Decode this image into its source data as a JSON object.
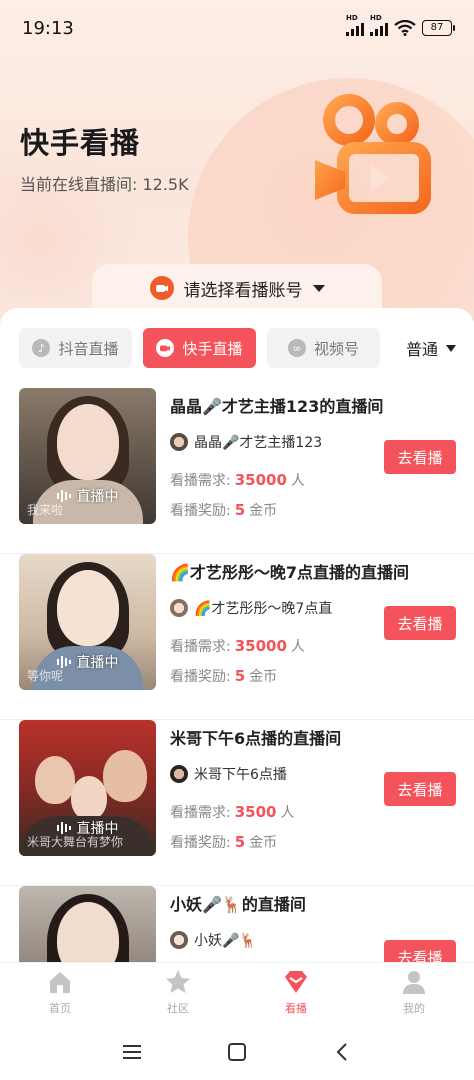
{
  "status_bar": {
    "time": "19:13",
    "battery": "87",
    "signal_badge": "HD"
  },
  "header": {
    "title": "快手看播",
    "subtitle": "当前在线直播间: 12.5K",
    "logo_icon": "kuaishou-logo-icon"
  },
  "account_selector": {
    "label": "请选择看播账号"
  },
  "tabs": [
    {
      "label": "抖音直播",
      "icon": "douyin-icon",
      "active": false
    },
    {
      "label": "快手直播",
      "icon": "kuaishou-icon",
      "active": true
    },
    {
      "label": "视频号",
      "icon": "channels-icon",
      "active": false
    }
  ],
  "mode": {
    "label": "普通"
  },
  "stream_list": [
    {
      "title": "晶晶🎤才艺主播123的直播间",
      "host": "晶晶🎤才艺主播123",
      "live_label": "直播中",
      "caption": "我来啦",
      "demand_label": "看播需求:",
      "demand_value": "35000",
      "demand_unit": "人",
      "reward_label": "看播奖励:",
      "reward_value": "5",
      "reward_unit": "金币",
      "button": "去看播"
    },
    {
      "title": "🌈才艺彤彤～晚7点直播的直播间",
      "host": "🌈才艺彤彤～晚7点直",
      "live_label": "直播中",
      "caption": "等你呢",
      "demand_label": "看播需求:",
      "demand_value": "35000",
      "demand_unit": "人",
      "reward_label": "看播奖励:",
      "reward_value": "5",
      "reward_unit": "金币",
      "button": "去看播"
    },
    {
      "title": "米哥下午6点播的直播间",
      "host": "米哥下午6点播",
      "live_label": "直播中",
      "caption": "米哥大舞台有梦你",
      "demand_label": "看播需求:",
      "demand_value": "3500",
      "demand_unit": "人",
      "reward_label": "看播奖励:",
      "reward_value": "5",
      "reward_unit": "金币",
      "button": "去看播"
    },
    {
      "title": "小妖🎤🦌的直播间",
      "host": "小妖🎤🦌",
      "live_label": "",
      "caption": "",
      "demand_label": "",
      "demand_value": "",
      "demand_unit": "",
      "reward_label": "",
      "reward_value": "",
      "reward_unit": "",
      "button": "去看播"
    }
  ],
  "bottom_nav": [
    {
      "label": "首页",
      "icon": "home-icon",
      "active": false
    },
    {
      "label": "社区",
      "icon": "star-icon",
      "active": false
    },
    {
      "label": "看播",
      "icon": "diamond-icon",
      "active": true
    },
    {
      "label": "我的",
      "icon": "person-icon",
      "active": false
    }
  ],
  "colors": {
    "accent": "#f5535b",
    "kuaishou_orange": "#f7812f"
  }
}
